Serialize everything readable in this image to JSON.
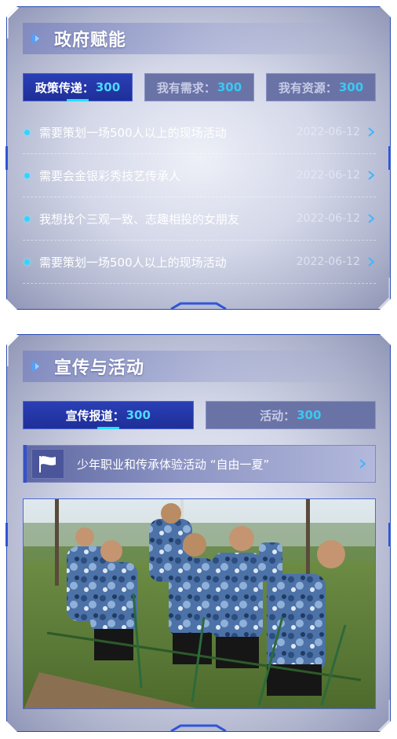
{
  "panel_gov": {
    "title": "政府赋能",
    "tabs": [
      {
        "label": "政策传递：",
        "count": "300",
        "active": true
      },
      {
        "label": "我有需求：",
        "count": "300",
        "active": false
      },
      {
        "label": "我有资源：",
        "count": "300",
        "active": false
      }
    ],
    "items": [
      {
        "text": "需要策划一场500人以上的现场活动",
        "date": "2022-06-12"
      },
      {
        "text": "需要会金银彩秀技艺传承人",
        "date": "2022-06-12"
      },
      {
        "text": "我想找个三观一致、志趣相投的女朋友",
        "date": "2022-06-12"
      },
      {
        "text": "需要策划一场500人以上的现场活动",
        "date": "2022-06-12"
      }
    ]
  },
  "panel_promo": {
    "title": "宣传与活动",
    "tabs": [
      {
        "label": "宣传报道：",
        "count": "300",
        "active": true
      },
      {
        "label": "活动：",
        "count": "300",
        "active": false
      }
    ],
    "feature": {
      "text": "少年职业和传承体验活动 “自由一夏”"
    },
    "photo_icon": "photo-image"
  },
  "colors": {
    "accent": "#2fd6ff",
    "tab_active": "#2a3fb6",
    "border": "#2a4bb0"
  },
  "icons": [
    "play-arrow-icon",
    "chevron-right-icon",
    "flag-icon"
  ]
}
